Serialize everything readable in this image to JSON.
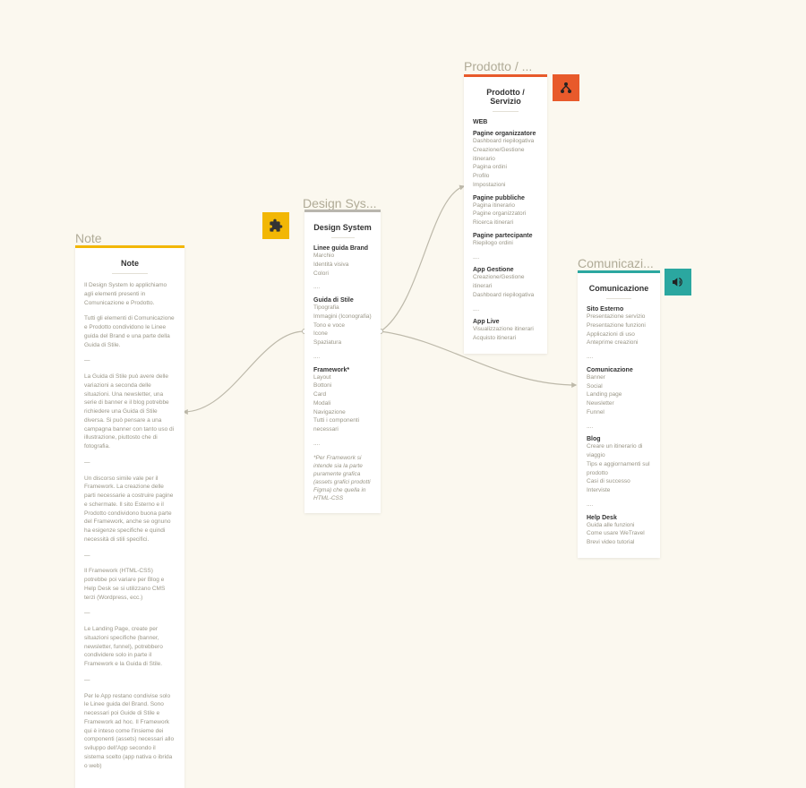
{
  "labels": {
    "note": "Note",
    "design": "Design Sys...",
    "prodotto": "Prodotto / ...",
    "comunicazione": "Comunicazi..."
  },
  "note": {
    "title": "Note",
    "p1": "Il Design System lo applichiamo agli elementi presenti in Comunicazione e Prodotto.",
    "p2": "Tutti gli elementi di Comunicazione e Prodotto condividono le Linee guida del Brand e una parte della Guida di Stile.",
    "sep1": "—",
    "p3": "La Guida di Stile può avere delle variazioni a seconda delle situazioni. Una newsletter, una serie di banner e il blog potrebbe richiedere una Guida di Stile diversa. Si può pensare a una campagna banner con tanto uso di illustrazione, piuttosto che di fotografia.",
    "sep2": "—",
    "p4": "Un discorso simile vale per il Framework. La creazione delle parti necessarie a costruire pagine e schermate. Il sito Esterno e il Prodotto condividono buona parte del Framework, anche se ognuno ha esigenze specifiche e quindi necessità di stili specifici.",
    "sep3": "—",
    "p5": "Il Framework (HTML-CSS) potrebbe poi variare per Blog e Help Desk se si utilizzano CMS terzi (Wordpress, ecc.)",
    "sep4": "—",
    "p6": "Le Landing Page, create per situazioni specifiche (banner, newsletter, funnel), potrebbero condividere solo in parte il Framework e la Guida di Stile.",
    "sep5": "—",
    "p7": "Per le App restano condivise solo le Linee guida del Brand. Sono necessari poi Guide di Stile e Framework ad hoc. Il Framework qui è inteso come l'insieme dei componenti (assets) necessari allo sviluppo dell'App secondo il sistema scelto (app nativa o ibrida o web)"
  },
  "design": {
    "title": "Design System",
    "s1": "Linee guida Brand",
    "s1_items": [
      "Marchio",
      "Identità visiva",
      "Colori"
    ],
    "dots1": "....",
    "s2": "Guida di Stile",
    "s2_items": [
      "Tipografia",
      "Immagini (Iconografia)",
      "Tono e voce",
      "Icone",
      "Spaziatura"
    ],
    "dots2": "....",
    "s3": "Framework*",
    "s3_items": [
      "Layout",
      "Bottoni",
      "Card",
      "Modali",
      "Navigazione",
      "Tutti i componenti necessari"
    ],
    "dots3": "....",
    "footnote": "*Per Framework si intende sia la parte puramente grafica (assets grafici prodotti Figma) che quella in HTML-CSS"
  },
  "prodotto": {
    "title": "Prodotto / Servizio",
    "web": "WEB",
    "s1": "Pagine organizzatore",
    "s1_items": [
      "Dashboard riepilogativa",
      "Creazione/Gestione itinerario",
      "Pagina ordini",
      "Profilo",
      "Impostazioni"
    ],
    "s2": "Pagine pubbliche",
    "s2_items": [
      "Pagina itinerario",
      "Pagine organizzatori",
      "Ricerca itinerari"
    ],
    "s3": "Pagine partecipante",
    "s3_items": [
      "Riepilogo ordini"
    ],
    "dots3": "....",
    "s4": "App Gestione",
    "s4_items": [
      "Creazione/Gestione itinerari",
      "Dashboard riepilogativa"
    ],
    "dots4": "....",
    "s5": "App Live",
    "s5_items": [
      "Visualizzazione itinerari",
      "Acquisto itinerari"
    ]
  },
  "comunicazione": {
    "title": "Comunicazione",
    "s1": "Sito Esterno",
    "s1_items": [
      "Presentazione servizio",
      "Presentazione funzioni",
      "Applicazioni di uso",
      "Anteprime creazioni"
    ],
    "dots1": "....",
    "s2": "Comunicazione",
    "s2_items": [
      "Banner",
      "Social",
      "Landing page",
      "Newsletter",
      "Funnel"
    ],
    "dots2": "....",
    "s3": "Blog",
    "s3_items": [
      "Creare un itinerario di viaggio",
      "Tips e aggiornamenti sul prodotto",
      "Casi di successo",
      "Interviste"
    ],
    "dots3": "....",
    "s4": "Help Desk",
    "s4_items": [
      "Guida alle funzioni",
      "Come usare WeTravel",
      "Brevi video tutorial"
    ]
  }
}
